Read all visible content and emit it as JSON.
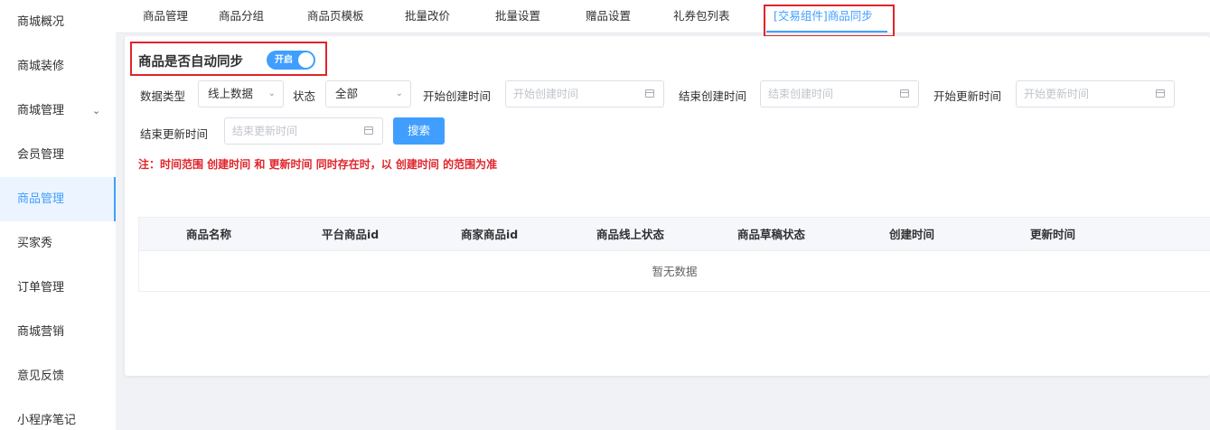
{
  "sidebar": {
    "items": [
      {
        "label": "商城概况"
      },
      {
        "label": "商城装修"
      },
      {
        "label": "商城管理",
        "has_chevron": true
      },
      {
        "label": "会员管理"
      },
      {
        "label": "商品管理",
        "active": true
      },
      {
        "label": "买家秀"
      },
      {
        "label": "订单管理"
      },
      {
        "label": "商城营销"
      },
      {
        "label": "意见反馈"
      },
      {
        "label": "小程序笔记"
      }
    ],
    "chevron_icon": "chevron-down-icon"
  },
  "tabs": [
    {
      "label": "商品管理"
    },
    {
      "label": "商品分组"
    },
    {
      "label": "商品页模板"
    },
    {
      "label": "批量改价"
    },
    {
      "label": "批量设置"
    },
    {
      "label": "赠品设置"
    },
    {
      "label": "礼券包列表"
    },
    {
      "label": "[交易组件]商品同步",
      "active": true
    }
  ],
  "sync": {
    "label": "商品是否自动同步",
    "switch_text": "开启",
    "switch_on": true
  },
  "filters": {
    "data_type_label": "数据类型",
    "data_type_value": "线上数据",
    "status_label": "状态",
    "status_value": "全部",
    "create_start_label": "开始创建时间",
    "create_start_placeholder": "开始创建时间",
    "create_end_label": "结束创建时间",
    "create_end_placeholder": "结束创建时间",
    "update_start_label": "开始更新时间",
    "update_start_placeholder": "开始更新时间",
    "update_end_label": "结束更新时间",
    "update_end_placeholder": "结束更新时间",
    "search_button": "搜索"
  },
  "note": "注：时间范围 创建时间 和 更新时间 同时存在时，以 创建时间 的范围为准",
  "table": {
    "columns": [
      "商品名称",
      "平台商品id",
      "商家商品id",
      "商品线上状态",
      "商品草稿状态",
      "创建时间",
      "更新时间"
    ],
    "empty_text": "暂无数据"
  },
  "colors": {
    "accent": "#409eff",
    "highlight_box": "#e0242b",
    "note": "#e0242b"
  }
}
